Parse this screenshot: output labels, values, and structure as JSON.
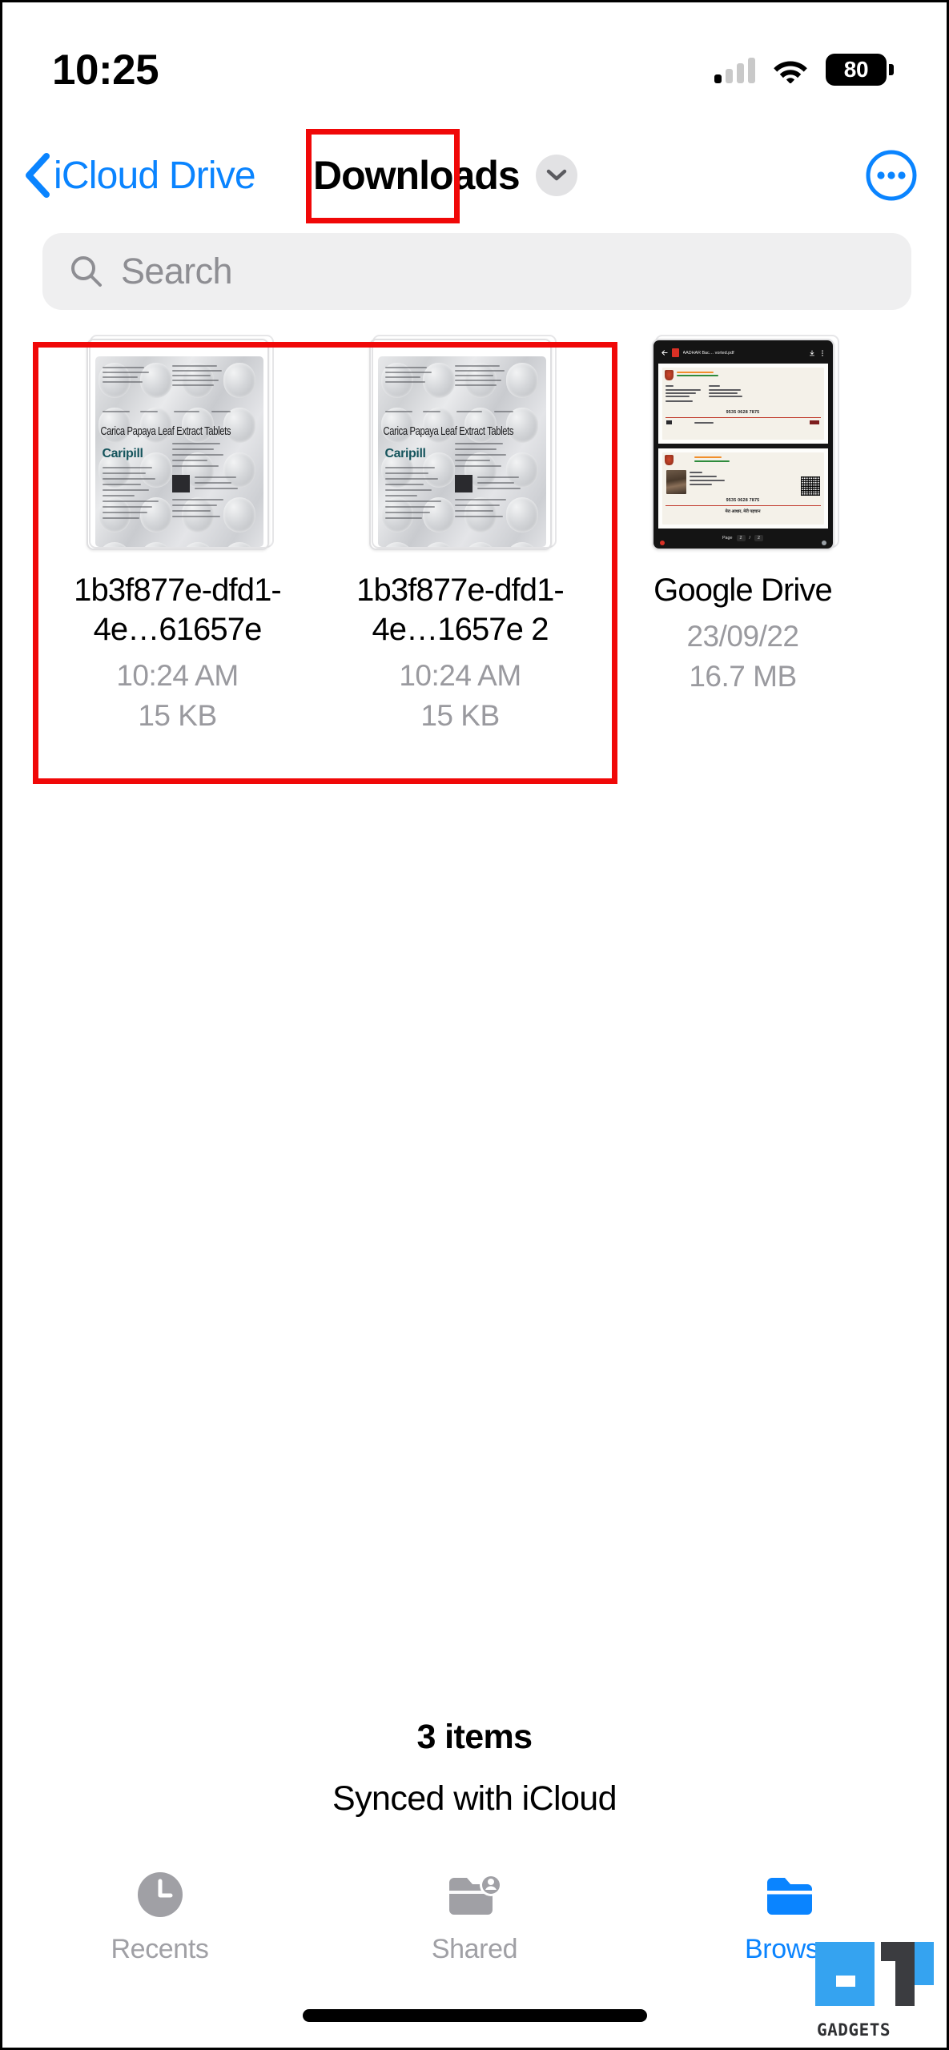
{
  "status_bar": {
    "time": "10:25",
    "battery_level": "80",
    "cellular_icon": "cellular-bars-icon",
    "wifi_icon": "wifi-icon",
    "battery_icon": "battery-icon"
  },
  "nav_bar": {
    "back_label": "iCloud Drive",
    "back_icon": "chevron-left-icon",
    "title": "Downloads",
    "title_chevron_icon": "chevron-down-icon",
    "more_icon": "ellipsis-circle-icon",
    "accent_color": "#0a84ff"
  },
  "search": {
    "placeholder": "Search",
    "icon": "search-icon",
    "value": ""
  },
  "files": [
    {
      "name": "1b3f877e-dfd1-4e…61657e",
      "date": "10:24 AM",
      "size": "15 KB",
      "thumbnail_kind": "pharma-blister-pack",
      "thumb_title": "Carica Papaya Leaf Extract Tablets",
      "thumb_brand": "Caripill"
    },
    {
      "name": "1b3f877e-dfd1-4e…1657e 2",
      "date": "10:24 AM",
      "size": "15 KB",
      "thumbnail_kind": "pharma-blister-pack",
      "thumb_title": "Carica Papaya Leaf Extract Tablets",
      "thumb_brand": "Caripill"
    },
    {
      "name": "Google Drive",
      "date": "23/09/22",
      "size": "16.7 MB",
      "thumbnail_kind": "pdf-screenshot-aadhaar",
      "thumb_filename": "AADHAR Bac… vorted.pdf",
      "thumb_id_number": "9535 0628 7875",
      "thumb_hindi_line": "मेरा आधार, मेरी पहचान",
      "thumb_page_label": "Page",
      "thumb_page_current": "2",
      "thumb_page_sep": "/",
      "thumb_page_total": "2"
    }
  ],
  "footer": {
    "items_count": "3 items",
    "sync_status": "Synced with iCloud"
  },
  "tab_bar": {
    "tabs": [
      {
        "label": "Recents",
        "icon": "clock-icon",
        "active": false
      },
      {
        "label": "Shared",
        "icon": "folder-person-icon",
        "active": false
      },
      {
        "label": "Browse",
        "icon": "folder-icon",
        "active": true
      }
    ]
  },
  "watermark": {
    "text": "GADGETS",
    "logo": "gt-logo-icon",
    "logo_blue": "#35a3f0",
    "logo_dark": "#3b3c40"
  },
  "annotations": {
    "highlight_color": "#f00808",
    "boxes": [
      {
        "name": "downloads-title-highlight"
      },
      {
        "name": "duplicate-files-highlight"
      }
    ]
  }
}
